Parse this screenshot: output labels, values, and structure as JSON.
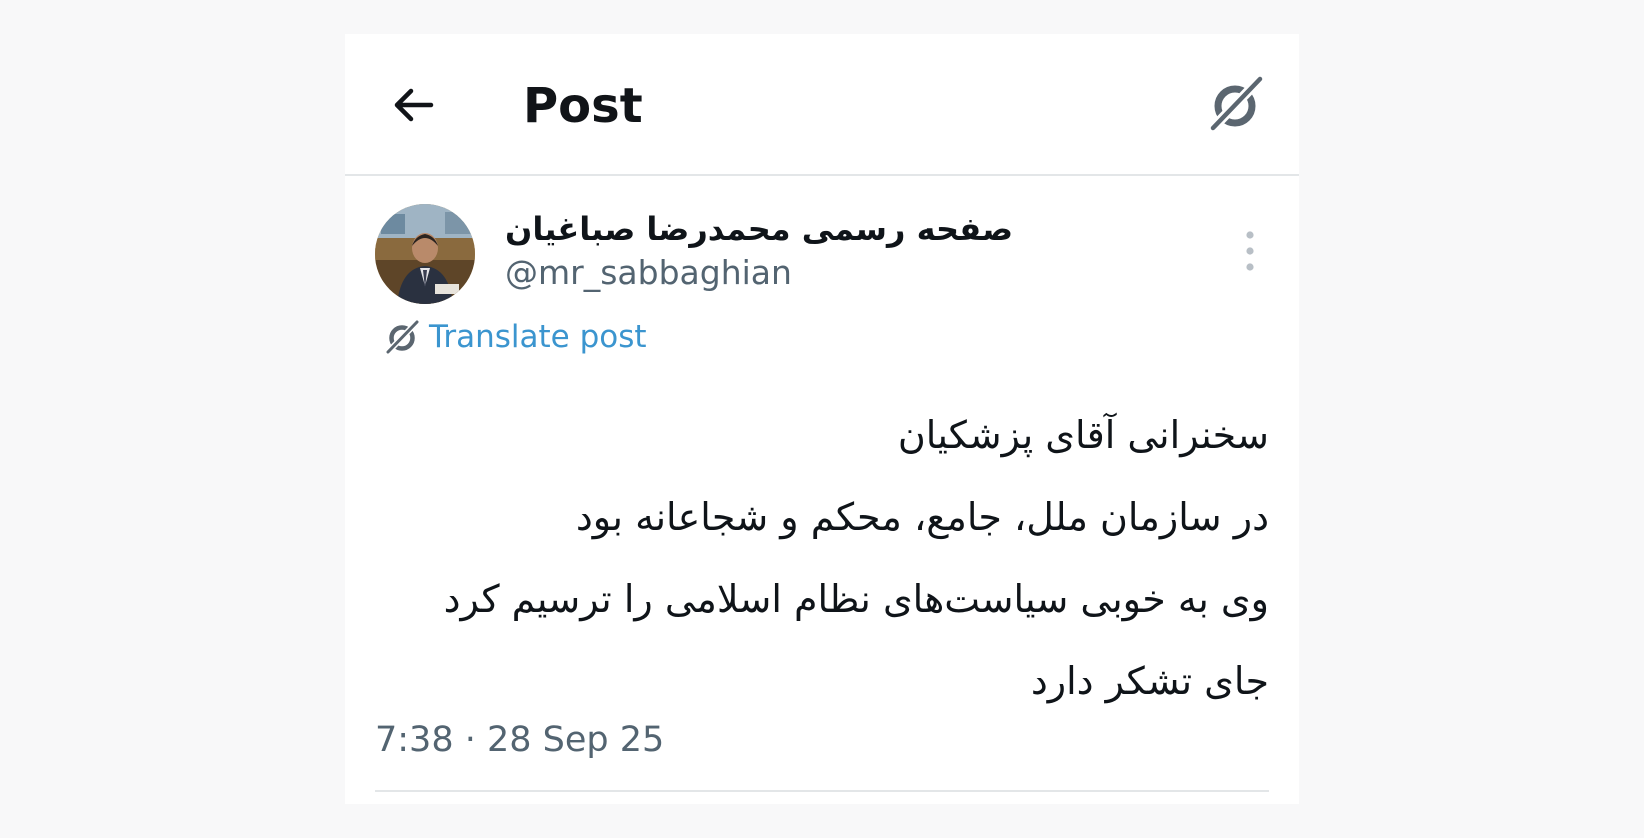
{
  "header": {
    "title": "Post",
    "back_icon": "arrow-left-icon",
    "grok_icon": "grok-icon"
  },
  "post": {
    "author": {
      "display_name": "صفحه رسمی محمدرضا صباغیان",
      "handle": "@mr_sabbaghian",
      "avatar_icon": "avatar"
    },
    "more_icon": "more-vertical-icon",
    "translate": {
      "label": "Translate post",
      "icon": "grok-icon"
    },
    "text_lines": [
      "سخنرانی آقای پزشکیان",
      "در سازمان ملل، جامع، محکم و شجاعانه بود",
      "وی به خوبی سیاست‌های نظام اسلامی را ترسیم کرد",
      "جای تشکر دارد"
    ],
    "timestamp": "7:38 · 28 Sep 25"
  },
  "colors": {
    "background": "#f8f8f9",
    "card": "#ffffff",
    "text": "#0f1419",
    "secondary_text": "#536471",
    "link": "#3b95cf",
    "divider": "#e3e6e8"
  }
}
